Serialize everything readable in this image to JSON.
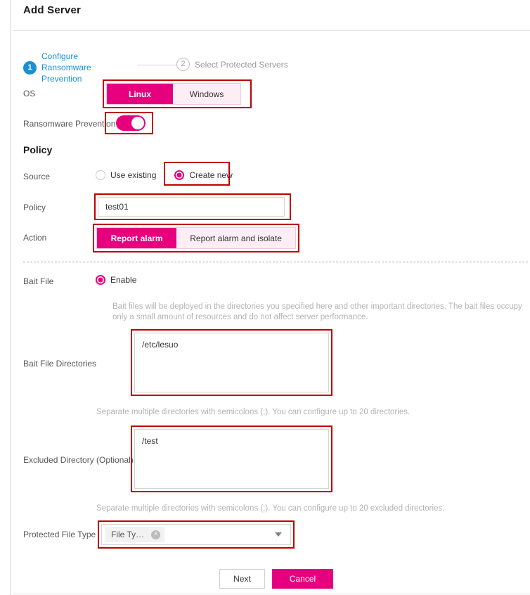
{
  "header": {
    "title": "Add Server"
  },
  "steps": [
    {
      "number": "1",
      "label": "Configure Ransomware Prevention",
      "state": "active"
    },
    {
      "number": "2",
      "label": "Select Protected Servers",
      "state": "inactive"
    }
  ],
  "os": {
    "label": "OS",
    "options": [
      "Linux",
      "Windows"
    ],
    "selected": "Linux"
  },
  "ransomware_prevention": {
    "label": "Ransomware Prevention",
    "enabled": true
  },
  "policy_section": {
    "title": "Policy",
    "source": {
      "label": "Source",
      "options": [
        "Use existing",
        "Create new"
      ],
      "selected": "Create new"
    },
    "policy": {
      "label": "Policy",
      "value": "test01",
      "placeholder": ""
    },
    "action": {
      "label": "Action",
      "options": [
        "Report alarm",
        "Report alarm and isolate"
      ],
      "selected": "Report alarm"
    }
  },
  "bait_file": {
    "label": "Bait File",
    "option_label": "Enable",
    "enabled": true,
    "description": "Bait files will be deployed in the directories you specified here and other important directories. The bait files occupy only a small amount of resources and do not affect server performance."
  },
  "bait_file_directories": {
    "label": "Bait File Directories",
    "value": "/etc/lesuo",
    "hint": "Separate multiple directories with semicolons (;). You can configure up to 20 directories."
  },
  "excluded_directory": {
    "label": "Excluded Directory (Optional)",
    "value": "/test",
    "hint": "Separate multiple directories with semicolons (;). You can configure up to 20 excluded directories."
  },
  "protected_file_type": {
    "label": "Protected File Type",
    "tag": "File Ty…",
    "remove_icon": "×"
  },
  "footer": {
    "next_label": "Next",
    "cancel_label": "Cancel"
  },
  "colors": {
    "accent": "#e6007e",
    "step_active": "#1890d8",
    "annotation": "#c00000"
  }
}
